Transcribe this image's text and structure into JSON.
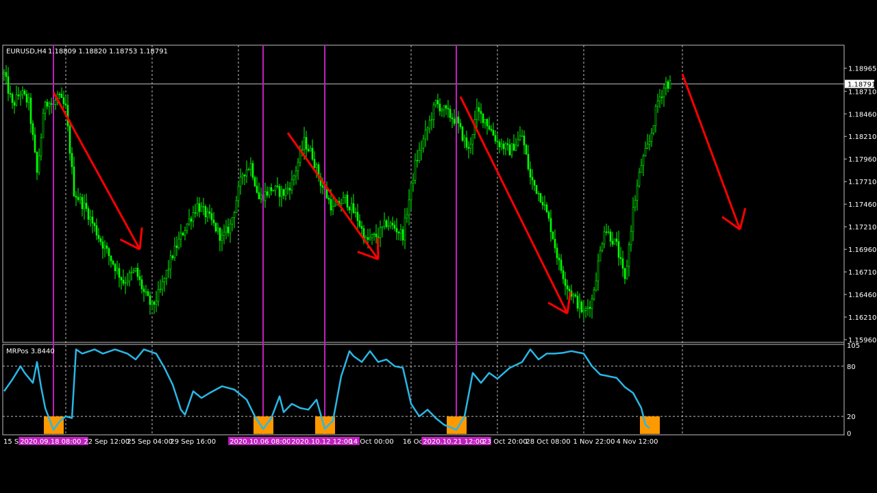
{
  "header": {
    "symbol_text": "EURUSD,H4",
    "ohlc_text": "1.18809 1.18820 1.18753 1.18791",
    "indicator_text": "MRPos 3.8440"
  },
  "colors": {
    "background": "#000000",
    "panel_border": "#c0c0c0",
    "candle": "#00ff00",
    "grid": "#c0c0c0",
    "vline": "#c020c0",
    "arrow": "#ff0000",
    "indicator_line": "#2ab7e6",
    "signal_box": "#ff9900"
  },
  "chart_data": [
    {
      "type": "candlestick",
      "title": "EURUSD,H4",
      "price_axis_ticks": [
        "1.18965",
        "1.18710",
        "1.18460",
        "1.18210",
        "1.17960",
        "1.17710",
        "1.17460",
        "1.17210",
        "1.16960",
        "1.16710",
        "1.16460",
        "1.16210",
        "1.15960"
      ],
      "price_axis_values": [
        1.18965,
        1.1871,
        1.1846,
        1.1821,
        1.1796,
        1.1771,
        1.1746,
        1.1721,
        1.1696,
        1.1671,
        1.1646,
        1.1621,
        1.1596
      ],
      "ylim": [
        1.1593,
        1.1922
      ],
      "current_price": "1.18791",
      "current_price_value": 1.18791,
      "close_path": [
        [
          0,
          1.189
        ],
        [
          4,
          1.1855
        ],
        [
          8,
          1.187
        ],
        [
          12,
          1.1858
        ],
        [
          16,
          1.178
        ],
        [
          20,
          1.1862
        ],
        [
          24,
          1.1855
        ],
        [
          26,
          1.1866
        ],
        [
          30,
          1.1852
        ],
        [
          34,
          1.176
        ],
        [
          40,
          1.174
        ],
        [
          46,
          1.171
        ],
        [
          52,
          1.1685
        ],
        [
          58,
          1.166
        ],
        [
          64,
          1.1672
        ],
        [
          68,
          1.1648
        ],
        [
          72,
          1.1632
        ],
        [
          76,
          1.165
        ],
        [
          82,
          1.169
        ],
        [
          88,
          1.172
        ],
        [
          94,
          1.1745
        ],
        [
          100,
          1.173
        ],
        [
          106,
          1.1708
        ],
        [
          110,
          1.1722
        ],
        [
          116,
          1.178
        ],
        [
          120,
          1.179
        ],
        [
          124,
          1.1752
        ],
        [
          130,
          1.1763
        ],
        [
          136,
          1.1758
        ],
        [
          140,
          1.177
        ],
        [
          146,
          1.1815
        ],
        [
          150,
          1.18
        ],
        [
          154,
          1.177
        ],
        [
          160,
          1.174
        ],
        [
          166,
          1.1752
        ],
        [
          172,
          1.173
        ],
        [
          176,
          1.1705
        ],
        [
          182,
          1.1712
        ],
        [
          186,
          1.1725
        ],
        [
          190,
          1.172
        ],
        [
          194,
          1.1712
        ],
        [
          200,
          1.179
        ],
        [
          206,
          1.183
        ],
        [
          210,
          1.1858
        ],
        [
          214,
          1.185
        ],
        [
          220,
          1.1838
        ],
        [
          226,
          1.1805
        ],
        [
          230,
          1.1848
        ],
        [
          234,
          1.184
        ],
        [
          240,
          1.1815
        ],
        [
          246,
          1.1805
        ],
        [
          252,
          1.1822
        ],
        [
          256,
          1.1775
        ],
        [
          262,
          1.175
        ],
        [
          266,
          1.172
        ],
        [
          270,
          1.168
        ],
        [
          274,
          1.1655
        ],
        [
          278,
          1.164
        ],
        [
          282,
          1.1625
        ],
        [
          286,
          1.164
        ],
        [
          292,
          1.172
        ],
        [
          298,
          1.17
        ],
        [
          302,
          1.166
        ],
        [
          306,
          1.174
        ],
        [
          310,
          1.179
        ],
        [
          314,
          1.1815
        ],
        [
          318,
          1.186
        ],
        [
          322,
          1.188
        ],
        [
          324,
          1.1879
        ]
      ],
      "arrows": [
        {
          "from": [
            24,
            1.187
          ],
          "to": [
            66,
            1.1696
          ]
        },
        {
          "from": [
            138,
            1.1825
          ],
          "to": [
            182,
            1.1685
          ]
        },
        {
          "from": [
            222,
            1.1865
          ],
          "to": [
            274,
            1.1625
          ]
        },
        {
          "from": [
            330,
            1.189
          ],
          "to": [
            358,
            1.1718
          ]
        }
      ],
      "signal_lines_bar": [
        24,
        126,
        156,
        220
      ],
      "grid_lines_bar": [
        30,
        72,
        114,
        156,
        198,
        240,
        282,
        330
      ],
      "time_labels": [
        {
          "text": "15 Sep",
          "bar": 0
        },
        {
          "text": "2020.09.18 08:00",
          "bar": 24,
          "highlight": true
        },
        {
          "text": "22 Sep 12:00",
          "bar": 51
        },
        {
          "text": "25 Sep 04:00",
          "bar": 72
        },
        {
          "text": "29 Sep 16:00",
          "bar": 93
        },
        {
          "text": "2020.10.06 08:00",
          "bar": 126,
          "highlight": true
        },
        {
          "text": "2020.10.12 12:00",
          "bar": 156,
          "highlight": true
        },
        {
          "text": "14 Oct 00:00",
          "bar": 180
        },
        {
          "text": "16 Oct",
          "bar": 200
        },
        {
          "text": "2020.10.21 12:00",
          "bar": 220,
          "highlight": true
        },
        {
          "text": "23 Oct 20:00",
          "bar": 245
        },
        {
          "text": "28 Oct 08:00",
          "bar": 266
        },
        {
          "text": "1 Nov 22:00",
          "bar": 288
        },
        {
          "text": "4 Nov 12:00",
          "bar": 309
        }
      ]
    },
    {
      "type": "line",
      "title": "MRPos 3.8440",
      "ylim": [
        -2,
        106
      ],
      "y_axis_ticks": [
        "105",
        "80",
        "20",
        "0"
      ],
      "y_axis_values": [
        105,
        80,
        20,
        0
      ],
      "levels": [
        80,
        20
      ],
      "series": [
        {
          "values_path": [
            [
              0,
              50
            ],
            [
              4,
              64
            ],
            [
              8,
              80
            ],
            [
              10,
              72
            ],
            [
              14,
              60
            ],
            [
              16,
              85
            ],
            [
              18,
              55
            ],
            [
              20,
              30
            ],
            [
              24,
              4
            ],
            [
              27,
              14
            ],
            [
              30,
              20
            ],
            [
              33,
              18
            ],
            [
              35,
              100
            ],
            [
              38,
              95
            ],
            [
              44,
              100
            ],
            [
              48,
              95
            ],
            [
              54,
              100
            ],
            [
              60,
              95
            ],
            [
              64,
              88
            ],
            [
              68,
              100
            ],
            [
              74,
              95
            ],
            [
              78,
              78
            ],
            [
              82,
              58
            ],
            [
              86,
              28
            ],
            [
              88,
              22
            ],
            [
              92,
              50
            ],
            [
              96,
              42
            ],
            [
              100,
              48
            ],
            [
              106,
              56
            ],
            [
              112,
              52
            ],
            [
              118,
              40
            ],
            [
              122,
              20
            ],
            [
              126,
              5
            ],
            [
              130,
              18
            ],
            [
              134,
              44
            ],
            [
              136,
              25
            ],
            [
              140,
              35
            ],
            [
              144,
              30
            ],
            [
              148,
              28
            ],
            [
              152,
              40
            ],
            [
              156,
              5
            ],
            [
              160,
              15
            ],
            [
              164,
              68
            ],
            [
              168,
              98
            ],
            [
              170,
              92
            ],
            [
              174,
              85
            ],
            [
              178,
              98
            ],
            [
              182,
              85
            ],
            [
              186,
              88
            ],
            [
              190,
              80
            ],
            [
              194,
              78
            ],
            [
              198,
              35
            ],
            [
              202,
              20
            ],
            [
              206,
              28
            ],
            [
              210,
              18
            ],
            [
              214,
              10
            ],
            [
              220,
              4
            ],
            [
              224,
              20
            ],
            [
              228,
              72
            ],
            [
              232,
              60
            ],
            [
              236,
              72
            ],
            [
              240,
              65
            ],
            [
              246,
              78
            ],
            [
              252,
              85
            ],
            [
              256,
              100
            ],
            [
              260,
              88
            ],
            [
              264,
              95
            ],
            [
              268,
              95
            ],
            [
              272,
              96
            ],
            [
              276,
              98
            ],
            [
              282,
              95
            ],
            [
              286,
              80
            ],
            [
              290,
              70
            ],
            [
              294,
              68
            ],
            [
              298,
              66
            ],
            [
              302,
              55
            ],
            [
              306,
              48
            ],
            [
              310,
              30
            ],
            [
              312,
              10
            ],
            [
              314,
              6
            ]
          ]
        }
      ],
      "signal_boxes_bar": [
        24,
        126,
        156,
        220,
        314
      ]
    }
  ]
}
